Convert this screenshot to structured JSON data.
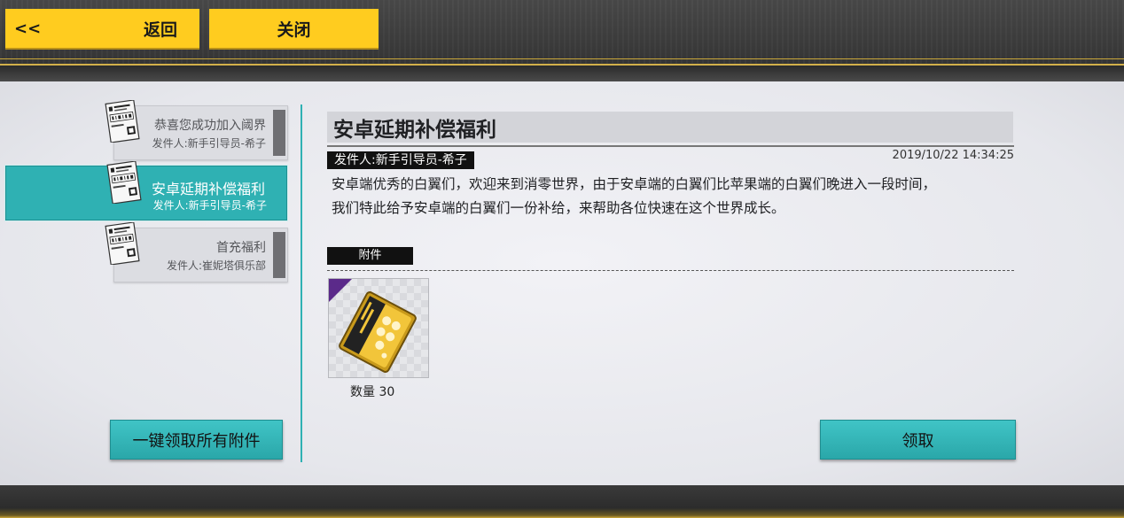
{
  "header": {
    "back_chevron": "<<",
    "back_label": "返回",
    "close_label": "关闭"
  },
  "mail_list": [
    {
      "title": "恭喜您成功加入阈界",
      "sender": "发件人:新手引导员-希子",
      "active": false
    },
    {
      "title": "安卓延期补偿福利",
      "sender": "发件人:新手引导员-希子",
      "active": true
    },
    {
      "title": "首充福利",
      "sender": "发件人:崔妮塔俱乐部",
      "active": false
    }
  ],
  "claim_all_label": "一键领取所有附件",
  "detail": {
    "title": "安卓延期补偿福利",
    "sender": "发件人:新手引导员-希子",
    "date": "2019/10/22 14:34:25",
    "body_line1": "安卓端优秀的白翼们，欢迎来到消零世界，由于安卓端的白翼们比苹果端的白翼们晚进入一段时间，",
    "body_line2": "我们特此给予安卓端的白翼们一份补给，来帮助各位快速在这个世界成长。",
    "attachments_label": "附件",
    "attachment": {
      "icon": "gold-ticket-icon",
      "quantity_label": "数量 30"
    },
    "claim_label": "领取"
  },
  "colors": {
    "accent_yellow": "#ffcc1f",
    "accent_teal": "#2fb1b3",
    "rarity_purple": "#5b2a8a"
  }
}
